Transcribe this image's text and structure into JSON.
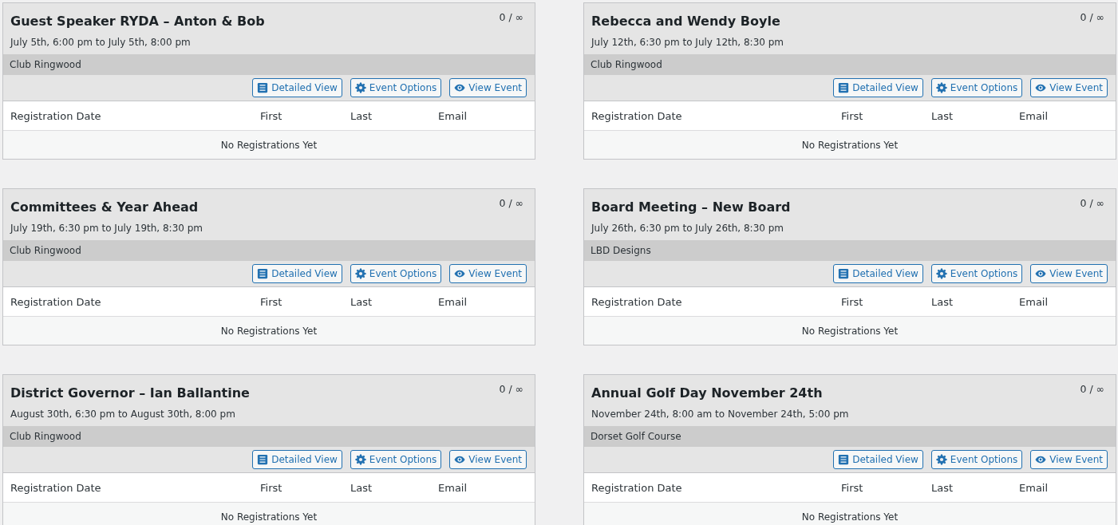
{
  "events": [
    {
      "title": "Guest Speaker RYDA – Anton & Bob",
      "count": "0 / ∞",
      "dates": "July 5th, 6:00 pm to July 5th, 8:00 pm",
      "venue": "Club Ringwood",
      "buttons": [
        {
          "label": "Detailed View",
          "kind": "detailed"
        },
        {
          "label": "Event Options",
          "kind": "options"
        },
        {
          "label": "View Event",
          "kind": "view"
        }
      ],
      "columns": [
        "Registration Date",
        "First",
        "Last",
        "Email"
      ],
      "empty_message": "No Registrations Yet"
    },
    {
      "title": "Rebecca and Wendy Boyle",
      "count": "0 / ∞",
      "dates": "July 12th, 6:30 pm to July 12th, 8:30 pm",
      "venue": "Club Ringwood",
      "buttons": [
        {
          "label": "Detailed View",
          "kind": "detailed"
        },
        {
          "label": "Event Options",
          "kind": "options"
        },
        {
          "label": "View Event",
          "kind": "view"
        }
      ],
      "columns": [
        "Registration Date",
        "First",
        "Last",
        "Email"
      ],
      "empty_message": "No Registrations Yet"
    },
    {
      "title": "Committees & Year Ahead",
      "count": "0 / ∞",
      "dates": "July 19th, 6:30 pm to July 19th, 8:30 pm",
      "venue": "Club Ringwood",
      "buttons": [
        {
          "label": "Detailed View",
          "kind": "detailed"
        },
        {
          "label": "Event Options",
          "kind": "options"
        },
        {
          "label": "View Event",
          "kind": "view"
        }
      ],
      "columns": [
        "Registration Date",
        "First",
        "Last",
        "Email"
      ],
      "empty_message": "No Registrations Yet"
    },
    {
      "title": "Board Meeting – New Board",
      "count": "0 / ∞",
      "dates": "July 26th, 6:30 pm to July 26th, 8:30 pm",
      "venue": "LBD Designs",
      "buttons": [
        {
          "label": "Detailed View",
          "kind": "detailed"
        },
        {
          "label": "Event Options",
          "kind": "options"
        },
        {
          "label": "View Event",
          "kind": "view"
        }
      ],
      "columns": [
        "Registration Date",
        "First",
        "Last",
        "Email"
      ],
      "empty_message": "No Registrations Yet"
    },
    {
      "title": "District Governor – Ian Ballantine",
      "count": "0 / ∞",
      "dates": "August 30th, 6:30 pm to August 30th, 8:00 pm",
      "venue": "Club Ringwood",
      "buttons": [
        {
          "label": "Detailed View",
          "kind": "detailed"
        },
        {
          "label": "Event Options",
          "kind": "options"
        },
        {
          "label": "View Event",
          "kind": "view"
        }
      ],
      "columns": [
        "Registration Date",
        "First",
        "Last",
        "Email"
      ],
      "empty_message": "No Registrations Yet"
    },
    {
      "title": "Annual Golf Day November 24th",
      "count": "0 / ∞",
      "dates": "November 24th, 8:00 am to November 24th, 5:00 pm",
      "venue": "Dorset Golf Course",
      "buttons": [
        {
          "label": "Detailed View",
          "kind": "detailed"
        },
        {
          "label": "Event Options",
          "kind": "options"
        },
        {
          "label": "View Event",
          "kind": "view"
        }
      ],
      "columns": [
        "Registration Date",
        "First",
        "Last",
        "Email"
      ],
      "empty_message": "No Registrations Yet"
    }
  ]
}
